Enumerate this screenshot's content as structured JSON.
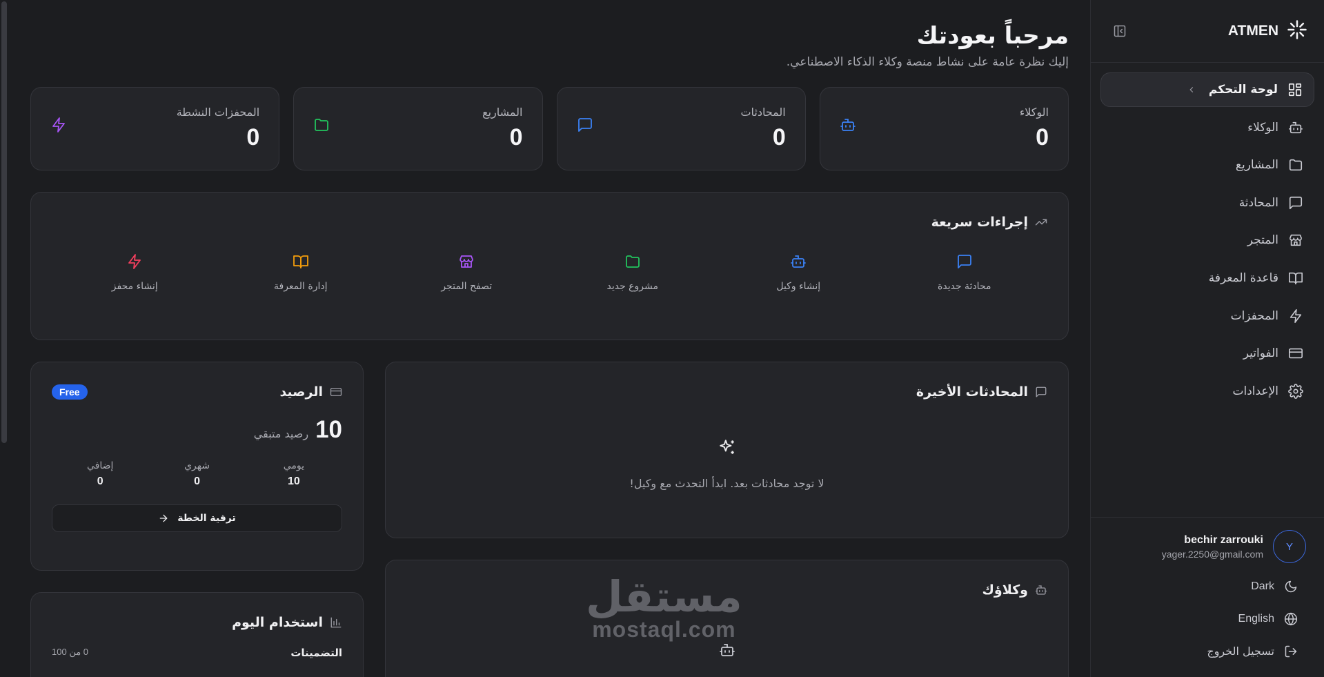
{
  "sidebar": {
    "brand": "ATMEN",
    "items": [
      {
        "label": "لوحة التحكم",
        "icon": "dashboard-icon",
        "active": true
      },
      {
        "label": "الوكلاء",
        "icon": "bot-icon"
      },
      {
        "label": "المشاريع",
        "icon": "folder-icon"
      },
      {
        "label": "المحادثة",
        "icon": "chat-icon"
      },
      {
        "label": "المتجر",
        "icon": "store-icon"
      },
      {
        "label": "قاعدة المعرفة",
        "icon": "book-icon"
      },
      {
        "label": "المحفزات",
        "icon": "lightning-icon"
      },
      {
        "label": "الفواتير",
        "icon": "credit-card-icon"
      },
      {
        "label": "الإعدادات",
        "icon": "gear-icon"
      }
    ],
    "user": {
      "initial": "Y",
      "name": "bechir zarrouki",
      "email": "yager.2250@gmail.com"
    },
    "theme_label": "Dark",
    "language_label": "English",
    "logout_label": "تسجيل الخروج"
  },
  "header": {
    "title": "مرحباً بعودتك",
    "subtitle": "إليك نظرة عامة على نشاط منصة وكلاء الذكاء الاصطناعي."
  },
  "stats": [
    {
      "label": "الوكلاء",
      "value": "0",
      "color": "#3b82f6"
    },
    {
      "label": "المحادثات",
      "value": "0",
      "color": "#3b82f6"
    },
    {
      "label": "المشاريع",
      "value": "0",
      "color": "#22c55e"
    },
    {
      "label": "المحفزات النشطة",
      "value": "0",
      "color": "#a855f7"
    }
  ],
  "quick_actions": {
    "title": "إجراءات سريعة",
    "items": [
      {
        "label": "محادثة جديدة",
        "color": "#3b82f6"
      },
      {
        "label": "إنشاء وكيل",
        "color": "#3b82f6"
      },
      {
        "label": "مشروع جديد",
        "color": "#22c55e"
      },
      {
        "label": "تصفح المتجر",
        "color": "#a855f7"
      },
      {
        "label": "إدارة المعرفة",
        "color": "#f59e0b"
      },
      {
        "label": "إنشاء محفز",
        "color": "#f43f5e"
      }
    ]
  },
  "recent": {
    "title": "المحادثات الأخيرة",
    "empty_text": "لا توجد محادثات بعد. ابدأ التحدث مع وكيل!"
  },
  "agents": {
    "title": "وكلاؤك"
  },
  "watermark": {
    "arabic": "مستقل",
    "latin": "mostaql.com"
  },
  "balance": {
    "title": "الرصيد",
    "badge": "Free",
    "amount": "10",
    "amount_label": "رصيد متبقي",
    "cells": [
      {
        "label": "يومي",
        "value": "10"
      },
      {
        "label": "شهري",
        "value": "0"
      },
      {
        "label": "إضافي",
        "value": "0"
      }
    ],
    "upgrade_label": "ترقية الخطة"
  },
  "usage": {
    "title": "استخدام اليوم",
    "rows": [
      {
        "label": "التضمينات",
        "value": "0 من 100"
      }
    ]
  }
}
